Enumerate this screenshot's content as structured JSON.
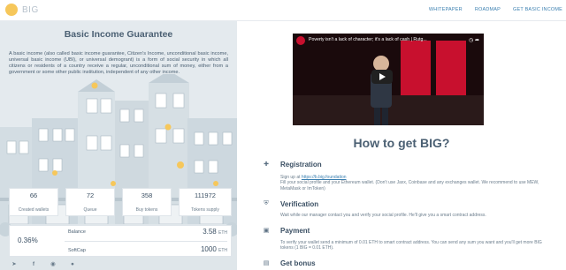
{
  "brand": {
    "logo_text": "BIG",
    "logo_color": "#f6c75b"
  },
  "nav": {
    "links": [
      "WHITEPAPER",
      "ROADMAP",
      "GET BASIC INCOME"
    ]
  },
  "left": {
    "title": "Basic Income Guarantee",
    "description": "A basic income (also called basic income guarantee, Citizen's Income, unconditional basic income, universal basic income (UBI), or universal demogrant) is a form of social security in which all citizens or residents of a country receive a regular, unconditional sum of money, either from a government or some other public institution, independent of any other income.",
    "stats": [
      {
        "value": "66",
        "label": "Created wallets"
      },
      {
        "value": "72",
        "label": "Queue"
      },
      {
        "value": "358",
        "label": "Buy tokens"
      },
      {
        "value": "111972",
        "label": "Tokens supply"
      }
    ],
    "balance": {
      "percent": "0.36%",
      "balance_label": "Balance",
      "balance_value": "3.58",
      "softcap_label": "SoftCap",
      "softcap_value": "1000",
      "unit": "ETH"
    },
    "social_icons": [
      "telegram-icon",
      "facebook-icon",
      "github-icon",
      "medium-icon"
    ]
  },
  "right": {
    "video_title": "Poverty isn't a lack of character; it's a lack of cash | Rutg...",
    "heading": "How to get BIG?",
    "steps": [
      {
        "icon": "user-plus-icon",
        "title": "Registration",
        "text_prefix": "Sign up at ",
        "link": "https://b.big.foundation",
        "text": "Fill your social profile and your Ethereum wallet. (Don't use Jaxx, Coinbase and any exchanges wallet. We recommend to use MEW, MetaMask or ImToken)"
      },
      {
        "icon": "shield-check-icon",
        "title": "Verification",
        "text": "Wait while our manager contact you and verify your social profile. He'll give you a smart contract address."
      },
      {
        "icon": "wallet-icon",
        "title": "Payment",
        "text": "To verify your wallet send a minimum of 0.01 ETH to smart contract address. You can send any sum you want and you'll get more BIG tokens (1 BIG = 0.01 ETH)."
      },
      {
        "icon": "bonus-icon",
        "title": "Get bonus"
      }
    ]
  }
}
